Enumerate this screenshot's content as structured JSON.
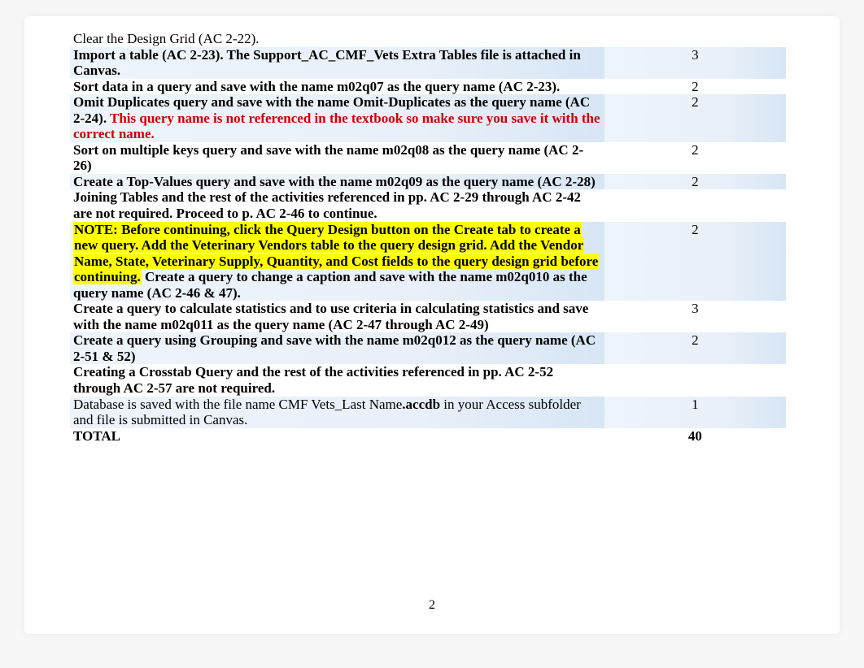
{
  "rows": [
    {
      "band": false,
      "points": "",
      "segs": [
        {
          "t": "Clear the Design Grid (AC 2-22).",
          "cls": ""
        }
      ]
    },
    {
      "band": true,
      "points": "3",
      "segs": [
        {
          "t": "Import a table (AC 2-23). The Support_AC_CMF_Vets Extra Tables file is attached in Canvas.",
          "cls": "bold"
        }
      ]
    },
    {
      "band": false,
      "points": "2",
      "segs": [
        {
          "t": "Sort data in a query and save with the name m02q07 as the query name (AC 2-23).",
          "cls": "bold"
        }
      ]
    },
    {
      "band": true,
      "points": "2",
      "segs": [
        {
          "t": "Omit Duplicates query and save with the name Omit-Duplicates as the query name (AC 2-24). ",
          "cls": "bold"
        },
        {
          "t": "This query name is not referenced in the textbook so make sure you save it with the correct name.",
          "cls": "red"
        }
      ]
    },
    {
      "band": false,
      "points": "2",
      "segs": [
        {
          "t": "Sort on multiple keys query and save with the name m02q08 as the query name (AC 2-26)",
          "cls": "bold"
        }
      ]
    },
    {
      "band": true,
      "points": "2",
      "segs": [
        {
          "t": "Create a Top-Values query and save with the name m02q09 as the query name (AC 2-28)",
          "cls": "bold"
        }
      ]
    },
    {
      "band": false,
      "points": "",
      "segs": [
        {
          "t": "Joining Tables and the rest of the activities referenced in pp. AC 2-29 through AC 2-42 are not required. Proceed to p. AC 2-46 to continue.",
          "cls": "bold"
        }
      ]
    },
    {
      "band": true,
      "points": "2",
      "segs": [
        {
          "t": "NOTE: Before continuing, click the Query Design button on the Create tab to create a new query. Add the Veterinary Vendors table to the query design grid. Add the Vendor Name, State, Veterinary Supply, Quantity, and Cost fields to the query design grid before continuing.",
          "cls": "bold hl"
        },
        {
          "t": " Create a query to change a caption and save with the name m02q010 as the query name (AC 2-46 & 47).",
          "cls": "bold"
        }
      ]
    },
    {
      "band": false,
      "points": "3",
      "segs": [
        {
          "t": "Create a query to calculate statistics and to use criteria in calculating statistics and save with the name m02q011 as the query name (AC 2-47 through AC 2-49)",
          "cls": "bold"
        }
      ]
    },
    {
      "band": true,
      "points": "2",
      "segs": [
        {
          "t": "Create a query using Grouping and save with the name m02q012 as the query name (AC 2-51 & 52)",
          "cls": "bold"
        }
      ]
    },
    {
      "band": false,
      "points": "",
      "segs": [
        {
          "t": "Creating a Crosstab Query and the rest of the activities referenced in pp. AC 2-52 through AC 2-57 are not required.",
          "cls": "bold"
        }
      ]
    },
    {
      "band": true,
      "points": "1",
      "segs": [
        {
          "t": "Database is saved with the file name CMF Vets_Last Name",
          "cls": ""
        },
        {
          "t": ".accdb",
          "cls": "bold"
        },
        {
          "t": " in your Access subfolder and file is submitted in Canvas.",
          "cls": ""
        }
      ]
    }
  ],
  "total_label": "TOTAL",
  "total_points": "40",
  "page_number": "2"
}
